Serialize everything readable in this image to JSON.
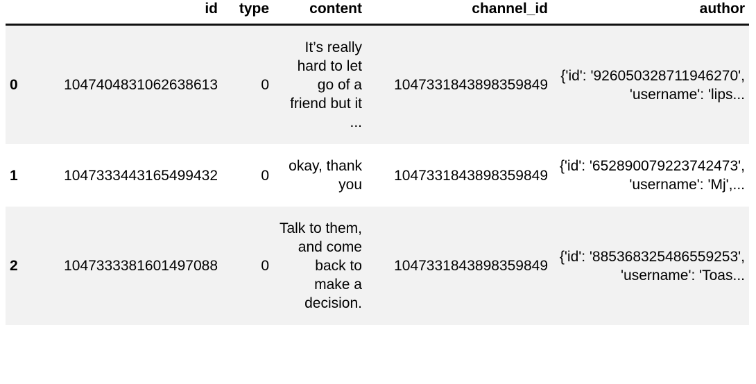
{
  "table": {
    "columns": [
      {
        "key": "index",
        "label": ""
      },
      {
        "key": "id",
        "label": "id"
      },
      {
        "key": "type",
        "label": "type"
      },
      {
        "key": "content",
        "label": "content"
      },
      {
        "key": "channel_id",
        "label": "channel_id"
      },
      {
        "key": "author",
        "label": "author"
      }
    ],
    "rows": [
      {
        "index": "0",
        "id": "1047404831062638613",
        "type": "0",
        "content": "It’s really hard to let go of a friend but it ...",
        "channel_id": "1047331843898359849",
        "author": "{'id': '926050328711946270', 'username': 'lips..."
      },
      {
        "index": "1",
        "id": "1047333443165499432",
        "type": "0",
        "content": "okay, thank you",
        "channel_id": "1047331843898359849",
        "author": "{'id': '652890079223742473', 'username': 'Mj',..."
      },
      {
        "index": "2",
        "id": "1047333381601497088",
        "type": "0",
        "content": "Talk to them, and come back to make a decision.",
        "channel_id": "1047331843898359849",
        "author": "{'id': '885368325486559253', 'username': 'Toas..."
      }
    ]
  },
  "style": {
    "stripe_color": "#f2f2f2",
    "base_color": "#ffffff",
    "text_color": "#000000",
    "header_rule_color": "#111111"
  }
}
